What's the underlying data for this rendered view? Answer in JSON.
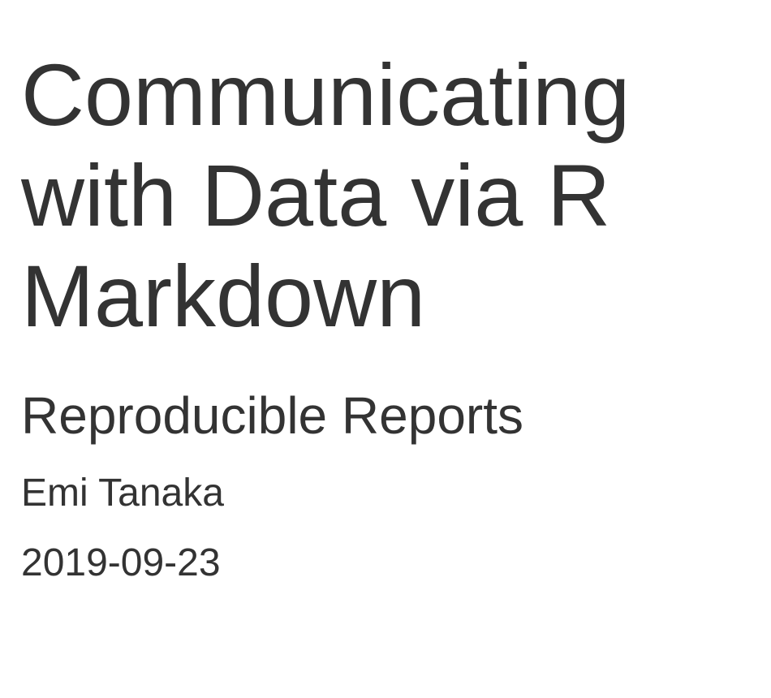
{
  "slide": {
    "title_lines": [
      "Communicating",
      "with Data via R",
      "Markdown"
    ],
    "subtitle": "Reproducible Reports",
    "author": "Emi Tanaka",
    "date": "2019-09-23"
  }
}
